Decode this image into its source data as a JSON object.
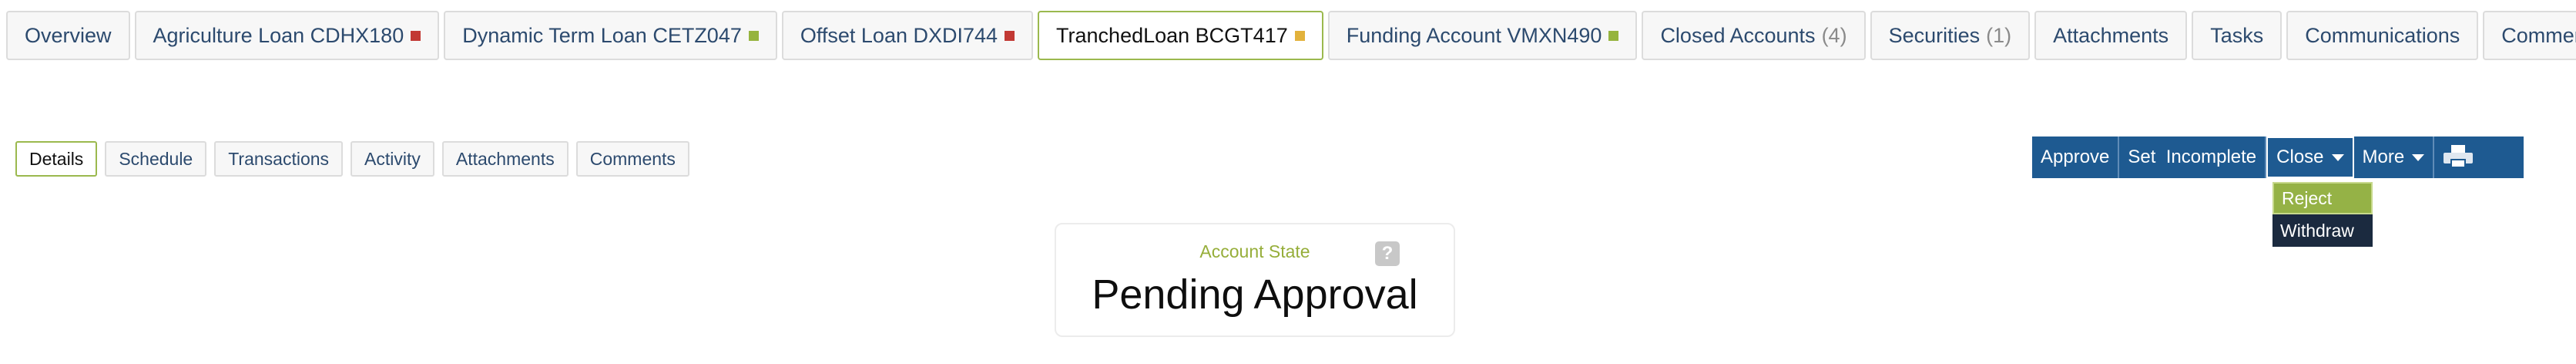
{
  "top_tabs": [
    {
      "label": "Overview"
    },
    {
      "label": "Agriculture Loan CDHX180",
      "status_color": "#c23934"
    },
    {
      "label": "Dynamic Term Loan CETZ047",
      "status_color": "#96b43e"
    },
    {
      "label": "Offset Loan DXDI744",
      "status_color": "#c23934"
    },
    {
      "label": "TranchedLoan BCGT417",
      "status_color": "#e2b23c",
      "active": true
    },
    {
      "label": "Funding Account VMXN490",
      "status_color": "#96b43e"
    },
    {
      "label": "Closed Accounts",
      "count": "(4)"
    },
    {
      "label": "Securities",
      "count": "(1)"
    },
    {
      "label": "Attachments"
    },
    {
      "label": "Tasks"
    },
    {
      "label": "Communications"
    },
    {
      "label": "Comments"
    }
  ],
  "sub_tabs": [
    {
      "label": "Details",
      "active": true
    },
    {
      "label": "Schedule"
    },
    {
      "label": "Transactions"
    },
    {
      "label": "Activity"
    },
    {
      "label": "Attachments"
    },
    {
      "label": "Comments"
    }
  ],
  "actions": {
    "approve": "Approve",
    "set_incomplete": "Set  Incomplete",
    "close": "Close",
    "more": "More",
    "print_icon": "printer-icon"
  },
  "close_menu": {
    "items": [
      {
        "label": "Reject",
        "selected": true
      },
      {
        "label": "Withdraw"
      }
    ]
  },
  "account_state": {
    "label": "Account State",
    "help": "?",
    "value": "Pending Approval"
  },
  "colors": {
    "accent_green": "#9bb94e",
    "action_bar_blue": "#1e5a91",
    "dropdown_dark": "#1b2a3f",
    "link_blue": "#2c4a6e"
  }
}
